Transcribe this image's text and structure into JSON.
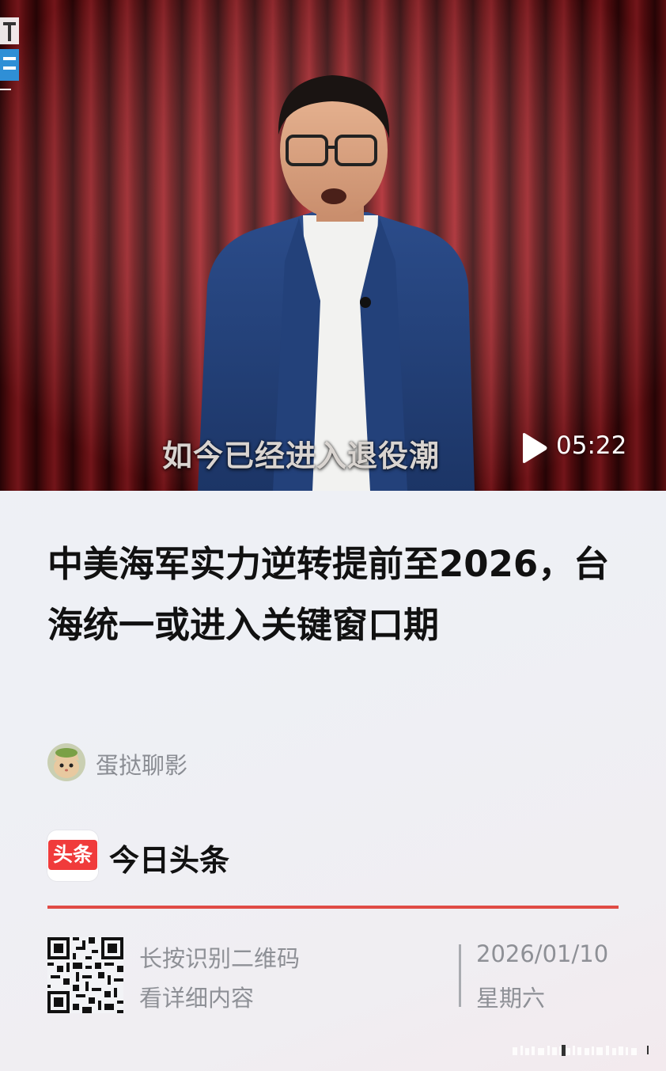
{
  "video": {
    "subtitle": "如今已经进入退役潮",
    "duration": "05:22",
    "play_icon": "play-icon",
    "corner_logo_chars": "锋 天"
  },
  "article": {
    "title": "中美海军实力逆转提前至2026，台海统一或进入关键窗口期",
    "author": {
      "name": "蛋挞聊影",
      "avatar_icon": "cat-avatar"
    }
  },
  "brand": {
    "logo_text": "头条",
    "name": "今日头条",
    "accent_color": "#f03b3b"
  },
  "footer": {
    "qr_hint_line1": "长按识别二维码",
    "qr_hint_line2": "看详细内容",
    "date": "2026/01/10",
    "weekday": "星期六",
    "divider_color": "#e04b45"
  }
}
